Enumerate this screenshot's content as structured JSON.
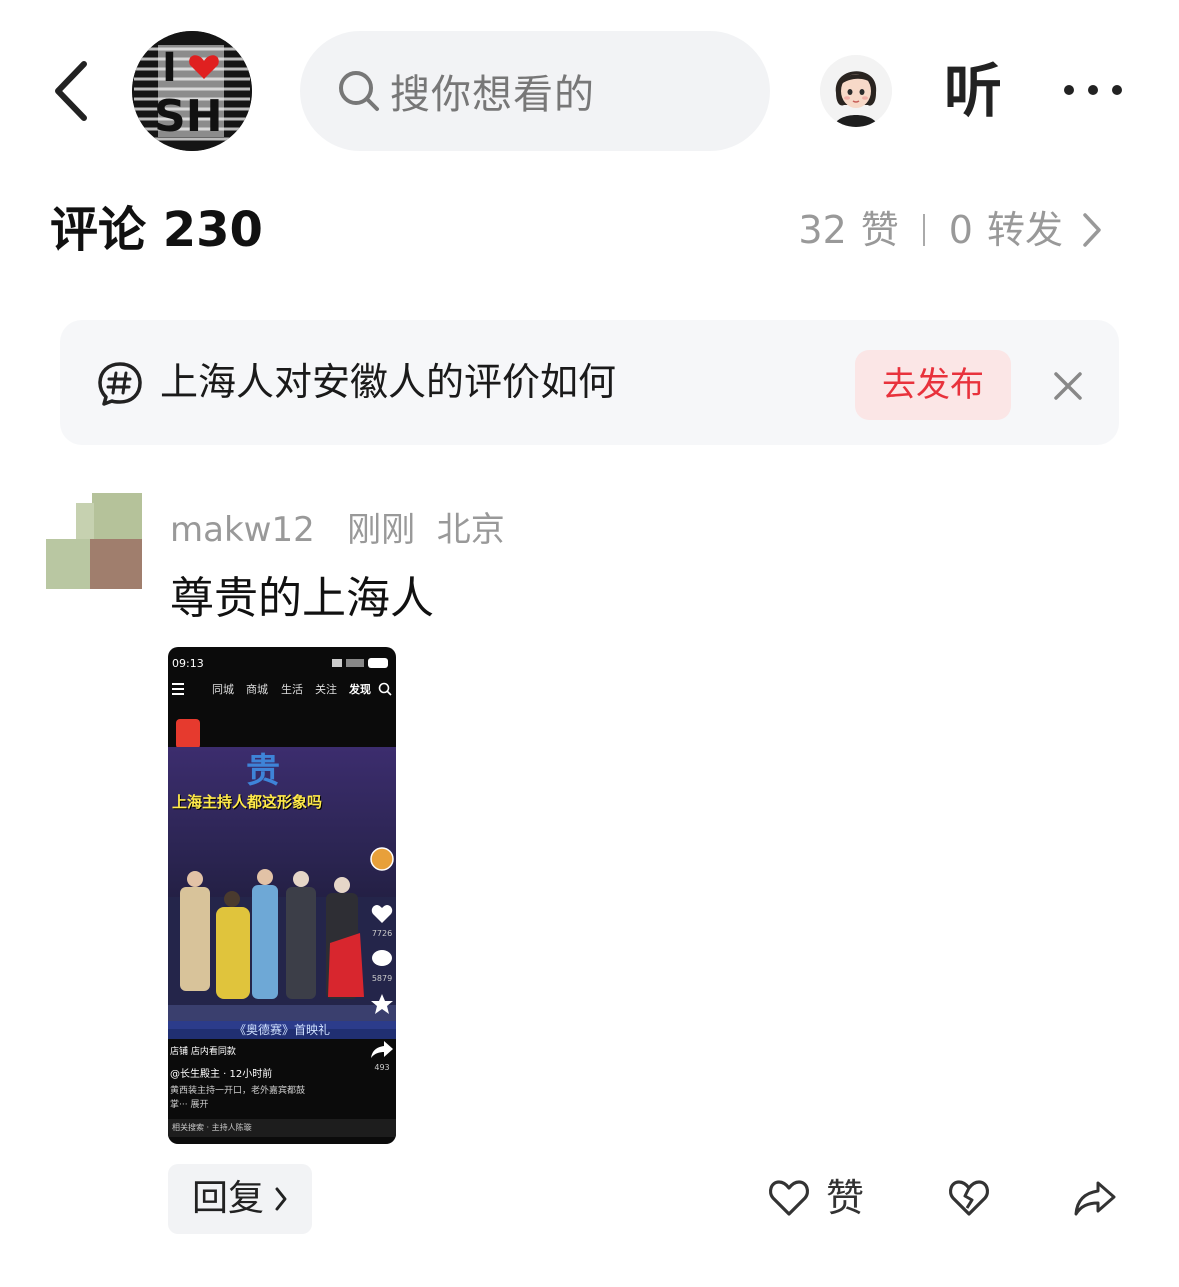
{
  "header": {
    "back_icon": "chevron-left-icon",
    "logo_text_top": "I",
    "logo_text_bottom": "SH",
    "search_placeholder": "搜你想看的",
    "listen_label": "听",
    "more_icon": "more-horizontal-icon"
  },
  "comments": {
    "title": "评论 230",
    "likes_count": "32",
    "likes_label": "赞",
    "reposts_count": "0",
    "reposts_label": "转发"
  },
  "topic": {
    "text": "上海人对安徽人的评价如何",
    "publish_label": "去发布"
  },
  "comment": {
    "username": "makw12",
    "time": "刚刚",
    "location": "北京",
    "text": "尊贵的上海人",
    "reply_label": "回复",
    "like_label": "赞"
  },
  "screenshot": {
    "status_time": "09:13",
    "tabs": [
      "同城",
      "商城",
      "生活",
      "关注",
      "发现"
    ],
    "big_char": "贵",
    "headline": "上海主持人都这形象吗",
    "caption": "《奥德赛》首映礼",
    "side_counts": [
      "7726",
      "5879",
      "493"
    ],
    "shop_label": "店铺  店内看同款",
    "author": "@长生殿主 · 12小时前",
    "desc1": "黄西装主持一开口，老外嘉宾都鼓",
    "desc2": "掌··· 展开",
    "related": "相关搜索 · 主持人陈璇"
  },
  "colors": {
    "accent_red": "#e8323c",
    "publish_bg": "#fbe6e6",
    "search_bg": "#f2f3f5",
    "muted_text": "#999999"
  }
}
